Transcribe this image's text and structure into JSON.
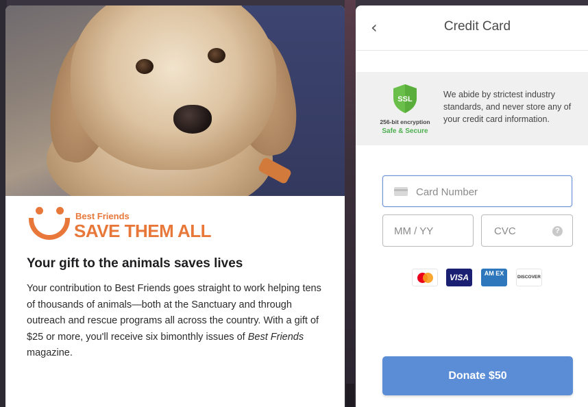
{
  "promo": {
    "logo_small": "Best Friends",
    "logo_big": "SAVE THEM ALL",
    "headline": "Your gift to the animals saves lives",
    "body_before": "Your contribution to Best Friends goes straight to work helping tens of thousands of animals—both at the Sanctuary and through outreach and rescue programs all across the country. With a gift of $25 or more, you'll receive six bimonthly issues of ",
    "body_emphasis": "Best Friends",
    "body_after": " magazine."
  },
  "panel": {
    "back_icon": "chevron-left-icon",
    "back_glyph": "‹",
    "title": "Credit Card"
  },
  "security": {
    "badge_label": "SSL",
    "encryption": "256-bit encryption",
    "safe": "Safe & Secure",
    "note": "We abide by strictest industry standards, and never store any of your credit card information.",
    "shield_color": "#6abf4b"
  },
  "form": {
    "card_number_placeholder": "Card Number",
    "card_number_value": "",
    "expiry_placeholder": "MM / YY",
    "expiry_value": "",
    "cvc_placeholder": "CVC",
    "cvc_value": "",
    "cvc_help": "?"
  },
  "card_brands": {
    "mastercard": "mastercard",
    "visa": "VISA",
    "amex": "AM EX",
    "discover": "DISCOVER"
  },
  "donate": {
    "label": "Donate $50",
    "color": "#5b8dd6"
  }
}
